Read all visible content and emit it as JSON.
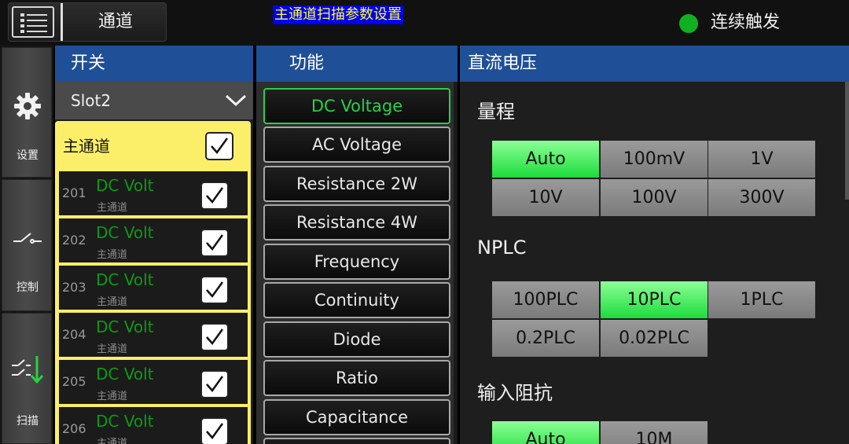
{
  "topbar": {
    "menu_icon": "list-icon",
    "menu_label": "通道",
    "title": "主通道扫描参数设置",
    "trigger_label": "连续触发",
    "trigger_color": "#10b020"
  },
  "nav": [
    {
      "label": "设置",
      "icon": "gear-icon"
    },
    {
      "label": "控制",
      "icon": "switch-icon"
    },
    {
      "label": "扫描",
      "icon": "scan-icon"
    }
  ],
  "columns": {
    "switch_header": "开关",
    "function_header": "功能",
    "settings_header": "直流电压"
  },
  "switch": {
    "slot_value": "Slot2",
    "main_channel_label": "主通道",
    "main_channel_checked": true,
    "channels": [
      {
        "num": "201",
        "func": "DC Volt",
        "sub": "主通道",
        "checked": true
      },
      {
        "num": "202",
        "func": "DC Volt",
        "sub": "主通道",
        "checked": true
      },
      {
        "num": "203",
        "func": "DC Volt",
        "sub": "主通道",
        "checked": true
      },
      {
        "num": "204",
        "func": "DC Volt",
        "sub": "主通道",
        "checked": true
      },
      {
        "num": "205",
        "func": "DC Volt",
        "sub": "主通道",
        "checked": true
      },
      {
        "num": "206",
        "func": "DC Volt",
        "sub": "主通道",
        "checked": true
      }
    ]
  },
  "functions": [
    {
      "label": "DC Voltage",
      "active": true
    },
    {
      "label": "AC Voltage",
      "active": false
    },
    {
      "label": "Resistance 2W",
      "active": false
    },
    {
      "label": "Resistance 4W",
      "active": false
    },
    {
      "label": "Frequency",
      "active": false
    },
    {
      "label": "Continuity",
      "active": false
    },
    {
      "label": "Diode",
      "active": false
    },
    {
      "label": "Ratio",
      "active": false
    },
    {
      "label": "Capacitance",
      "active": false
    }
  ],
  "settings": {
    "range": {
      "label": "量程",
      "options": [
        "Auto",
        "100mV",
        "1V",
        "10V",
        "100V",
        "300V"
      ],
      "selected": "Auto"
    },
    "nplc": {
      "label": "NPLC",
      "options": [
        "100PLC",
        "10PLC",
        "1PLC",
        "0.2PLC",
        "0.02PLC"
      ],
      "selected": "10PLC"
    },
    "impedance": {
      "label": "输入阻抗",
      "options": [
        "Auto",
        "10M"
      ],
      "selected": "Auto"
    }
  },
  "colors": {
    "header_blue": "#1f4f97",
    "channel_yellow": "#fbef6a",
    "selected_green": "#1cdc3c",
    "func_active_green": "#26d04a"
  }
}
